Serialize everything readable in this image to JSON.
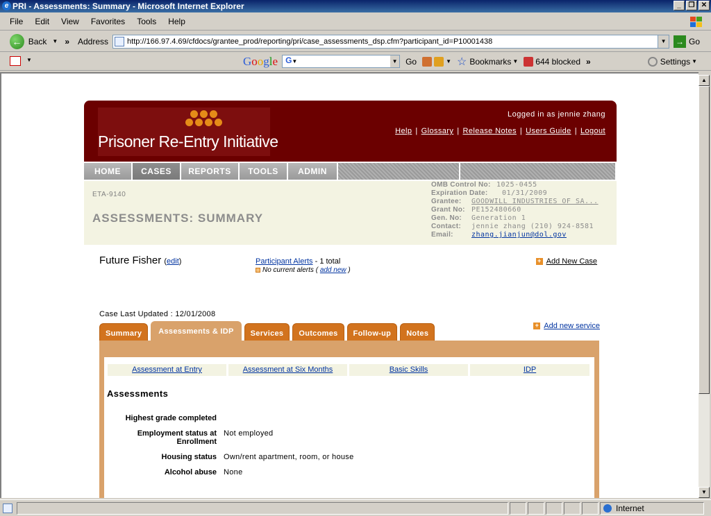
{
  "window": {
    "title": "PRI - Assessments: Summary - Microsoft Internet Explorer"
  },
  "menu": [
    "File",
    "Edit",
    "View",
    "Favorites",
    "Tools",
    "Help"
  ],
  "address_bar": {
    "back_label": "Back",
    "address_label": "Address",
    "url": "http://166.97.4.69/cfdocs/grantee_prod/reporting/pri/case_assessments_dsp.cfm?participant_id=P10001438",
    "go_label": "Go"
  },
  "toolbar2": {
    "google": "Google",
    "go": "Go",
    "bookmarks": "Bookmarks",
    "blocked": "644 blocked",
    "settings": "Settings"
  },
  "site": {
    "logo_text": "Prisoner Re-Entry Initiative",
    "logged_in": "Logged in as jennie zhang",
    "links": [
      "Help",
      "Glossary",
      "Release Notes",
      "Users Guide",
      "Logout"
    ],
    "nav": [
      {
        "label": "HOME"
      },
      {
        "label": "CASES"
      },
      {
        "label": "REPORTS"
      },
      {
        "label": "TOOLS"
      },
      {
        "label": "ADMIN"
      }
    ],
    "form_id": "ETA-9140",
    "page_title": "ASSESSMENTS: SUMMARY",
    "meta": {
      "omb_label": "OMB Control No:",
      "omb": "1025-0455",
      "exp_label": "Expiration Date:",
      "exp": "01/31/2009",
      "grantee_label": "Grantee:",
      "grantee": "GOODWILL INDUSTRIES OF SA...",
      "grant_label": "Grant No:",
      "grant": "PE152480660",
      "gen_label": "Gen. No:",
      "gen": "Generation 1",
      "contact_label": "Contact:",
      "contact": "jennie zhang  (210) 924-8581",
      "email_label": "Email:",
      "email": "zhang.jianjun@dol.gov"
    },
    "participant": {
      "name": "Future Fisher",
      "edit": "edit"
    },
    "alerts": {
      "link": "Participant Alerts",
      "total": " - 1 total",
      "none": "No current alerts (",
      "add_new": "add new",
      "close": ")"
    },
    "add_new_case": "Add New Case",
    "case_last_updated": "Case Last Updated : 12/01/2008",
    "tabs": [
      {
        "label": "Summary"
      },
      {
        "label": "Assessments & IDP"
      },
      {
        "label": "Services"
      },
      {
        "label": "Outcomes"
      },
      {
        "label": "Follow-up"
      },
      {
        "label": "Notes"
      }
    ],
    "add_new_service": "Add new service",
    "subtabs": [
      {
        "label": "Assessment at Entry"
      },
      {
        "label": "Assessment at Six Months"
      },
      {
        "label": "Basic Skills"
      },
      {
        "label": "IDP"
      }
    ],
    "section_heading": "Assessments",
    "fields": [
      {
        "label": "Highest grade completed",
        "value": ""
      },
      {
        "label": "Employment status at Enrollment",
        "value": "Not employed"
      },
      {
        "label": "Housing status",
        "value": "Own/rent apartment, room, or house"
      },
      {
        "label": "Alcohol abuse",
        "value": "None"
      }
    ]
  },
  "status": {
    "zone": "Internet"
  }
}
